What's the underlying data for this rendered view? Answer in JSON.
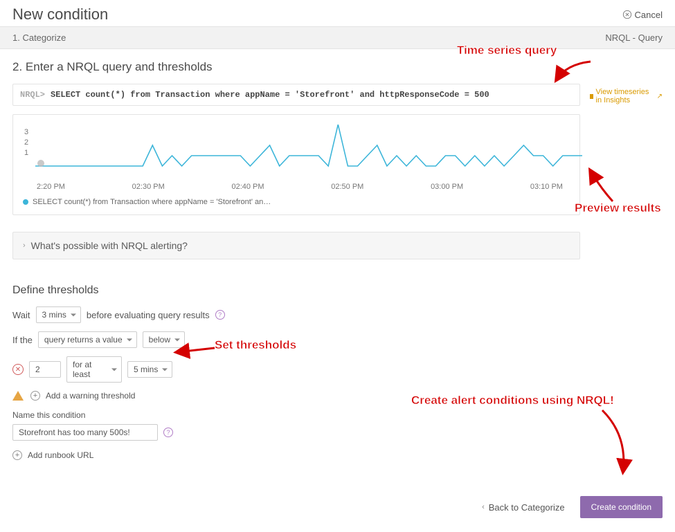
{
  "header": {
    "title": "New condition",
    "cancel": "Cancel"
  },
  "breadcrumb": {
    "step1": "1. Categorize",
    "right": "NRQL - Query"
  },
  "step": {
    "title": "2. Enter a NRQL query and thresholds",
    "prefix": "NRQL>",
    "query": "SELECT count(*) from Transaction where appName = 'Storefront' and httpResponseCode = 500",
    "insights_link": "View timeseries in Insights"
  },
  "chart_data": {
    "type": "line",
    "title": "",
    "xlabel": "",
    "ylabel": "",
    "ylim": [
      0,
      4
    ],
    "yticks": [
      1,
      2,
      3
    ],
    "xticks": [
      "2:20 PM",
      "02:30 PM",
      "02:40 PM",
      "02:50 PM",
      "03:00 PM",
      "03:10 PM"
    ],
    "series": [
      {
        "name": "SELECT count(*) from Transaction where appName = 'Storefront' an…",
        "values": [
          0,
          0,
          0,
          0,
          0,
          0,
          0,
          0,
          0,
          0,
          0,
          0,
          2,
          0,
          1,
          0,
          1,
          1,
          1,
          1,
          1,
          1,
          0,
          1,
          2,
          0,
          1,
          1,
          1,
          1,
          0,
          4,
          0,
          0,
          1,
          2,
          0,
          1,
          0,
          1,
          0,
          0,
          1,
          1,
          0,
          1,
          0,
          1,
          0,
          1,
          2,
          1,
          1,
          0,
          1,
          1,
          1
        ]
      }
    ],
    "legend_label": "SELECT count(*) from Transaction where appName = 'Storefront' an…"
  },
  "expander": {
    "label": "What's possible with NRQL alerting?"
  },
  "thresholds": {
    "title": "Define thresholds",
    "wait_label": "Wait",
    "wait_value": "3 mins",
    "wait_after": "before evaluating query results",
    "if_label": "If the",
    "if_condition": "query returns a value",
    "if_direction": "below",
    "critical_value": "2",
    "critical_for": "for at least",
    "critical_duration": "5 mins",
    "add_warning": "Add a warning threshold"
  },
  "name_section": {
    "label": "Name this condition",
    "value": "Storefront has too many 500s!",
    "add_runbook": "Add runbook URL"
  },
  "footer": {
    "back": "Back to Categorize",
    "submit": "Create condition"
  },
  "annotations": {
    "a1": "Time series query",
    "a2": "Preview results",
    "a3": "Set thresholds",
    "a4": "Create alert conditions using NRQL!"
  }
}
